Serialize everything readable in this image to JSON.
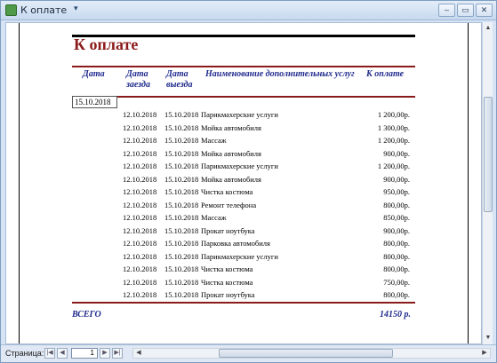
{
  "window": {
    "title": "К оплате",
    "pin_glyph": "▾",
    "buttons": [
      "–",
      "▭",
      "✕"
    ]
  },
  "report": {
    "title": "К оплате",
    "headers": {
      "date": "Дата",
      "checkin": "Дата\nзаезда",
      "checkout": "Дата\nвыезда",
      "service": "Наименование дополнительных услуг",
      "amount": "К оплате"
    },
    "group_date": "15.10.2018",
    "rows": [
      {
        "checkin": "12.10.2018",
        "checkout": "15.10.2018",
        "service": "Парикмахерские услуги",
        "amount": "1 200,00р."
      },
      {
        "checkin": "12.10.2018",
        "checkout": "15.10.2018",
        "service": "Мойка автомобиля",
        "amount": "1 300,00р."
      },
      {
        "checkin": "12.10.2018",
        "checkout": "15.10.2018",
        "service": "Массаж",
        "amount": "1 200,00р."
      },
      {
        "checkin": "12.10.2018",
        "checkout": "15.10.2018",
        "service": "Мойка автомобиля",
        "amount": "900,00р."
      },
      {
        "checkin": "12.10.2018",
        "checkout": "15.10.2018",
        "service": "Парикмахерские услуги",
        "amount": "1 200,00р."
      },
      {
        "checkin": "12.10.2018",
        "checkout": "15.10.2018",
        "service": "Мойка автомобиля",
        "amount": "900,00р."
      },
      {
        "checkin": "12.10.2018",
        "checkout": "15.10.2018",
        "service": "Чистка костюма",
        "amount": "950,00р."
      },
      {
        "checkin": "12.10.2018",
        "checkout": "15.10.2018",
        "service": "Ремонт телефона",
        "amount": "800,00р."
      },
      {
        "checkin": "12.10.2018",
        "checkout": "15.10.2018",
        "service": "Массаж",
        "amount": "850,00р."
      },
      {
        "checkin": "12.10.2018",
        "checkout": "15.10.2018",
        "service": "Прокат ноутбука",
        "amount": "900,00р."
      },
      {
        "checkin": "12.10.2018",
        "checkout": "15.10.2018",
        "service": "Парковка автомобиля",
        "amount": "800,00р."
      },
      {
        "checkin": "12.10.2018",
        "checkout": "15.10.2018",
        "service": "Парикмахерские услуги",
        "amount": "800,00р."
      },
      {
        "checkin": "12.10.2018",
        "checkout": "15.10.2018",
        "service": "Чистка костюма",
        "amount": "800,00р."
      },
      {
        "checkin": "12.10.2018",
        "checkout": "15.10.2018",
        "service": "Чистка костюма",
        "amount": "750,00р."
      },
      {
        "checkin": "12.10.2018",
        "checkout": "15.10.2018",
        "service": "Прокат ноутбука",
        "amount": "800,00р."
      }
    ],
    "total_label": "ВСЕГО",
    "total_value": "14150 р."
  },
  "statusbar": {
    "page_label": "Страница:",
    "page_number": "1",
    "nav_first": "|◀",
    "nav_prev": "◀",
    "nav_next": "▶",
    "nav_last": "▶|"
  }
}
